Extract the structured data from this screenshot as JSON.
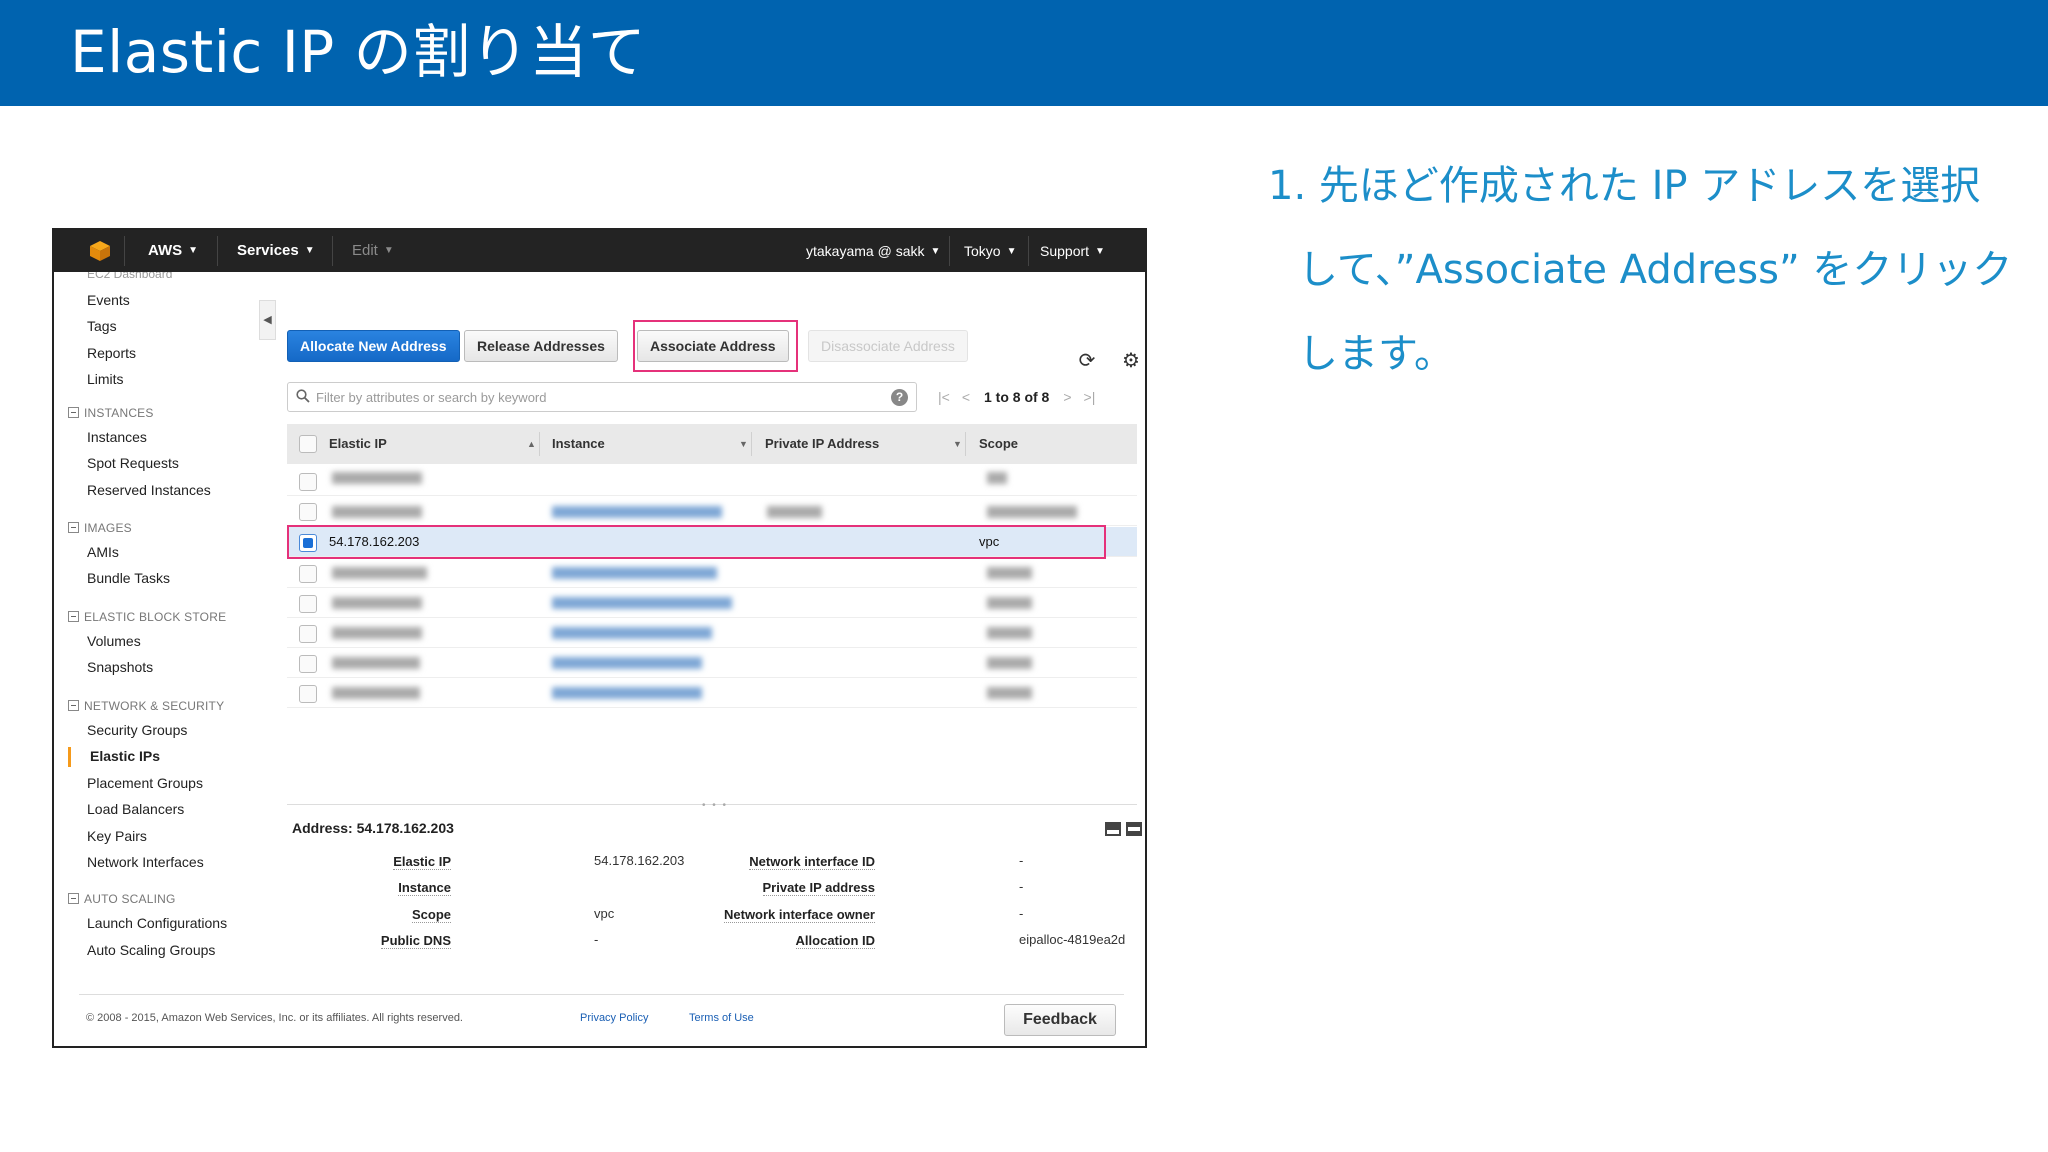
{
  "slide": {
    "title": "Elastic IP の割り当て",
    "instruction": [
      "1. 先ほど作成された IP アドレスを選択",
      "して、”Associate Address” をクリック",
      "します。"
    ]
  },
  "topnav": {
    "brand": "AWS",
    "services": "Services",
    "edit": "Edit",
    "user": "ytakayama @ sakk",
    "region": "Tokyo",
    "support": "Support"
  },
  "sidebar": {
    "top_items": [
      "Events",
      "Tags",
      "Reports",
      "Limits"
    ],
    "sections": [
      {
        "title": "INSTANCES",
        "items": [
          "Instances",
          "Spot Requests",
          "Reserved Instances"
        ]
      },
      {
        "title": "IMAGES",
        "items": [
          "AMIs",
          "Bundle Tasks"
        ]
      },
      {
        "title": "ELASTIC BLOCK STORE",
        "items": [
          "Volumes",
          "Snapshots"
        ]
      },
      {
        "title": "NETWORK & SECURITY",
        "items": [
          "Security Groups",
          "Elastic IPs",
          "Placement Groups",
          "Load Balancers",
          "Key Pairs",
          "Network Interfaces"
        ]
      },
      {
        "title": "AUTO SCALING",
        "items": [
          "Launch Configurations",
          "Auto Scaling Groups"
        ]
      }
    ],
    "active_item": "Elastic IPs"
  },
  "toolbar": {
    "allocate": "Allocate New Address",
    "release": "Release Addresses",
    "associate": "Associate Address",
    "disassociate": "Disassociate Address"
  },
  "search": {
    "placeholder": "Filter by attributes or search by keyword",
    "help": "?"
  },
  "pager": {
    "text": "1 to 8 of 8"
  },
  "table": {
    "columns": [
      "Elastic IP",
      "Instance",
      "Private IP Address",
      "Scope"
    ],
    "selected_row": {
      "elastic_ip": "54.178.162.203",
      "scope": "vpc"
    }
  },
  "detail": {
    "title": "Address: 54.178.162.203",
    "left": [
      {
        "label": "Elastic IP",
        "value": "54.178.162.203"
      },
      {
        "label": "Instance",
        "value": ""
      },
      {
        "label": "Scope",
        "value": "vpc"
      },
      {
        "label": "Public DNS",
        "value": "-"
      }
    ],
    "right": [
      {
        "label": "Network interface ID",
        "value": "-"
      },
      {
        "label": "Private IP address",
        "value": "-"
      },
      {
        "label": "Network interface owner",
        "value": "-"
      },
      {
        "label": "Allocation ID",
        "value": "eipalloc-4819ea2d"
      }
    ]
  },
  "footer": {
    "copyright": "© 2008 - 2015, Amazon Web Services, Inc. or its affiliates. All rights reserved.",
    "privacy": "Privacy Policy",
    "terms": "Terms of Use",
    "feedback": "Feedback"
  },
  "colors": {
    "header_blue": "#0063af",
    "instruction_blue": "#1c8ec9",
    "highlight_pink": "#e5317a",
    "primary_button": "#1a73e8"
  }
}
